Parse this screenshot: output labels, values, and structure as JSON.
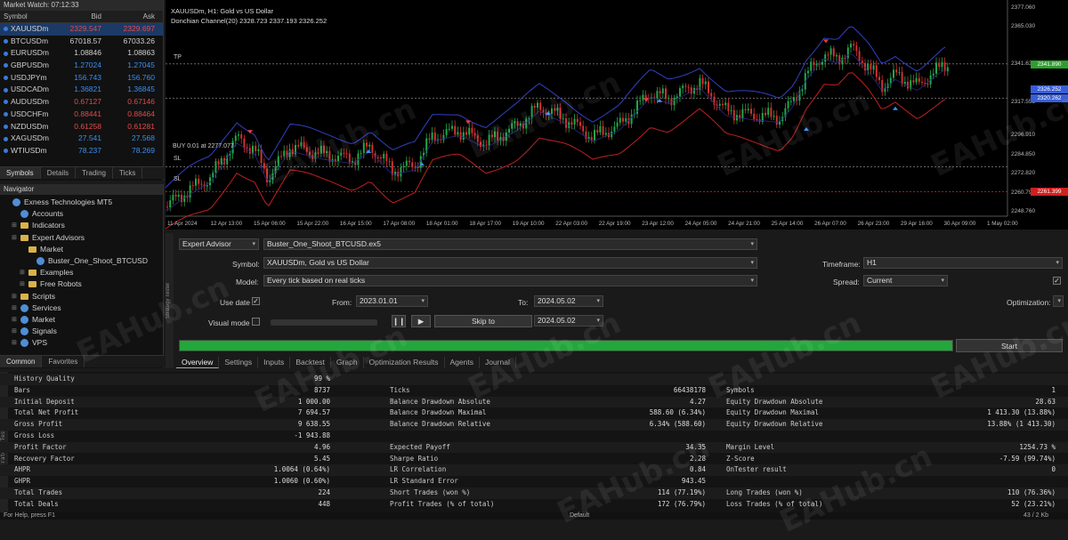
{
  "market_watch": {
    "title": "Market Watch: 07:12:33",
    "headers": [
      "Symbol",
      "Bid",
      "Ask"
    ],
    "rows": [
      {
        "symbol": "XAUUSDm",
        "bid": "2329.547",
        "ask": "2329.697",
        "dir": "dn"
      },
      {
        "symbol": "BTCUSDm",
        "bid": "67018.57",
        "ask": "67033.26",
        "dir": "nb"
      },
      {
        "symbol": "EURUSDm",
        "bid": "1.08846",
        "ask": "1.08863",
        "dir": "nb"
      },
      {
        "symbol": "GBPUSDm",
        "bid": "1.27024",
        "ask": "1.27045",
        "dir": "up"
      },
      {
        "symbol": "USDJPYm",
        "bid": "156.743",
        "ask": "156.760",
        "dir": "up"
      },
      {
        "symbol": "USDCADm",
        "bid": "1.36821",
        "ask": "1.36845",
        "dir": "up"
      },
      {
        "symbol": "AUDUSDm",
        "bid": "0.67127",
        "ask": "0.67146",
        "dir": "dn"
      },
      {
        "symbol": "USDCHFm",
        "bid": "0.88441",
        "ask": "0.88464",
        "dir": "dn"
      },
      {
        "symbol": "NZDUSDm",
        "bid": "0.61258",
        "ask": "0.61281",
        "dir": "dn"
      },
      {
        "symbol": "XAGUSDm",
        "bid": "27.541",
        "ask": "27.568",
        "dir": "up"
      },
      {
        "symbol": "WTIUSDm",
        "bid": "78.237",
        "ask": "78.269",
        "dir": "up"
      }
    ],
    "tabs": [
      "Symbols",
      "Details",
      "Trading",
      "Ticks"
    ]
  },
  "navigator": {
    "title": "Navigator",
    "items": [
      {
        "label": "Exness Technologies MT5",
        "icon": "terminal-icon",
        "indent": 0
      },
      {
        "label": "Accounts",
        "icon": "accounts-icon",
        "indent": 1
      },
      {
        "label": "Indicators",
        "icon": "indicators-icon",
        "indent": 1
      },
      {
        "label": "Expert Advisors",
        "icon": "expert-advisors-icon",
        "indent": 1
      },
      {
        "label": "Market",
        "icon": "folder-icon",
        "indent": 2
      },
      {
        "label": "Buster_One_Shoot_BTCUSD",
        "icon": "expert-icon",
        "indent": 3
      },
      {
        "label": "Examples",
        "icon": "folder-icon",
        "indent": 2
      },
      {
        "label": "Free Robots",
        "icon": "folder-icon",
        "indent": 2
      },
      {
        "label": "Scripts",
        "icon": "scripts-icon",
        "indent": 1
      },
      {
        "label": "Services",
        "icon": "services-icon",
        "indent": 1
      },
      {
        "label": "Market",
        "icon": "market-icon",
        "indent": 1
      },
      {
        "label": "Signals",
        "icon": "signals-icon",
        "indent": 1
      },
      {
        "label": "VPS",
        "icon": "vps-icon",
        "indent": 1
      }
    ],
    "tabs": [
      "Common",
      "Favorites"
    ]
  },
  "chart": {
    "title": "XAUUSDm, H1:  Gold vs US Dollar",
    "indicator": "Donchian Channel(20) 2328.723 2337.193 2326.252",
    "buy_label": "BUY 0.01 at 2277.077",
    "tp_label": "TP",
    "sl_label": "SL",
    "price_ticks": [
      "2377.060",
      "2365.030",
      "2341.635",
      "2317.555",
      "2296.910",
      "2284.850",
      "2272.820",
      "2260.790",
      "2248.760"
    ],
    "price_labels": [
      {
        "text": "2341.890",
        "color": "#2e9e2e"
      },
      {
        "text": "2326.252",
        "color": "#3a5ed6"
      },
      {
        "text": "2320.262",
        "color": "#3a5ed6"
      },
      {
        "text": "2261.399",
        "color": "#d02020"
      }
    ],
    "time_ticks": [
      "11 Apr 2024",
      "12 Apr 13:00",
      "15 Apr 06:00",
      "15 Apr 22:00",
      "16 Apr 15:00",
      "17 Apr 08:00",
      "18 Apr 01:00",
      "18 Apr 17:00",
      "19 Apr 10:00",
      "22 Apr 03:00",
      "22 Apr 19:00",
      "23 Apr 12:00",
      "24 Apr 05:00",
      "24 Apr 21:00",
      "25 Apr 14:00",
      "26 Apr 07:00",
      "26 Apr 23:00",
      "29 Apr 16:00",
      "30 Apr 09:00",
      "1 May 02:00"
    ]
  },
  "tester": {
    "type_value": "Expert Advisor",
    "expert_file": "Buster_One_Shoot_BTCUSD.ex5",
    "symbol_label": "Symbol:",
    "symbol_value": "XAUUSDm, Gold vs US Dollar",
    "timeframe_label": "Timeframe:",
    "timeframe_value": "H1",
    "model_label": "Model:",
    "model_value": "Every tick based on real ticks",
    "spread_label": "Spread:",
    "spread_value": "Current",
    "use_date_label": "Use date",
    "from_label": "From:",
    "from_value": "2023.01.01",
    "to_label": "To:",
    "to_value": "2024.05.02",
    "optimization_label": "Optimization:",
    "visual_mode_label": "Visual mode",
    "skip_to_label": "Skip to",
    "skip_to_value": "2024.05.02",
    "start_label": "Start",
    "progress": 1.0,
    "tabs": [
      "Overview",
      "Settings",
      "Inputs",
      "Backtest",
      "Graph",
      "Optimization Results",
      "Agents",
      "Journal"
    ],
    "side_label": "Strategy Tester"
  },
  "results": {
    "col1": [
      [
        "History Quality",
        "99 %"
      ],
      [
        "Bars",
        "8737"
      ],
      [
        "Initial Deposit",
        "1 000.00"
      ],
      [
        "Total Net Profit",
        "7 694.57"
      ],
      [
        "Gross Profit",
        "9 638.55"
      ],
      [
        "Gross Loss",
        "-1 943.88"
      ],
      [
        "Profit Factor",
        "4.96"
      ],
      [
        "Recovery Factor",
        "5.45"
      ],
      [
        "AHPR",
        "1.0064 (0.64%)"
      ],
      [
        "GHPR",
        "1.0060 (0.60%)"
      ],
      [
        "Total Trades",
        "224"
      ],
      [
        "Total Deals",
        "448"
      ]
    ],
    "col2": [
      [
        "",
        ""
      ],
      [
        "Ticks",
        "66438178"
      ],
      [
        "Balance Drawdown Absolute",
        "4.27"
      ],
      [
        "Balance Drawdown Maximal",
        "588.60 (6.34%)"
      ],
      [
        "Balance Drawdown Relative",
        "6.34% (588.60)"
      ],
      [
        "",
        ""
      ],
      [
        "Expected Payoff",
        "34.35"
      ],
      [
        "Sharpe Ratio",
        "2.28"
      ],
      [
        "LR Correlation",
        "0.84"
      ],
      [
        "LR Standard Error",
        "943.45"
      ],
      [
        "Short Trades (won %)",
        "114 (77.19%)"
      ],
      [
        "Profit Trades (% of total)",
        "172 (76.79%)"
      ]
    ],
    "col3": [
      [
        "",
        ""
      ],
      [
        "Symbols",
        "1"
      ],
      [
        "Equity Drawdown Absolute",
        "28.63"
      ],
      [
        "Equity Drawdown Maximal",
        "1 413.30 (13.88%)"
      ],
      [
        "Equity Drawdown Relative",
        "13.88% (1 413.30)"
      ],
      [
        "",
        ""
      ],
      [
        "Margin Level",
        "1254.73 %"
      ],
      [
        "Z-Score",
        "-7.59 (99.74%)"
      ],
      [
        "OnTester result",
        "0"
      ],
      [
        "",
        ""
      ],
      [
        "Long Trades (won %)",
        "110 (76.36%)"
      ],
      [
        "Loss Trades (% of total)",
        "52 (23.21%)"
      ]
    ],
    "status_left": "For Help, press F1",
    "status_mid": "Default",
    "status_right": "43 / 2 Kb"
  },
  "watermark": "EAHub.cn",
  "colors": {
    "bull": "#1fa84a",
    "bear": "#d23030",
    "donchian_upper": "#3340c0",
    "donchian_lower": "#c02020",
    "progress": "#22a83a"
  }
}
